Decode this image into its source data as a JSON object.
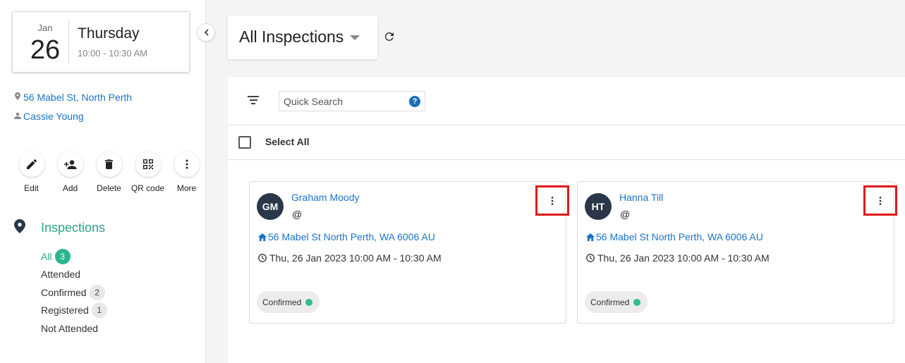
{
  "event": {
    "month": "Jan",
    "day": "26",
    "weekday": "Thursday",
    "time": "10:00 - 10:30 AM",
    "address": "56 Mabel St, North Perth",
    "agent": "Cassie Young"
  },
  "actions": [
    {
      "label": "Edit",
      "icon": "pencil-icon"
    },
    {
      "label": "Add",
      "icon": "add-person-icon"
    },
    {
      "label": "Delete",
      "icon": "trash-icon"
    },
    {
      "label": "QR code",
      "icon": "qr-code-icon"
    },
    {
      "label": "More",
      "icon": "more-vertical-icon"
    }
  ],
  "inspections": {
    "title": "Inspections",
    "filters": [
      {
        "label": "All",
        "count": "3"
      },
      {
        "label": "Attended",
        "count": null
      },
      {
        "label": "Confirmed",
        "count": "2"
      },
      {
        "label": "Registered",
        "count": "1"
      },
      {
        "label": "Not Attended",
        "count": null
      }
    ]
  },
  "main": {
    "title": "All Inspections",
    "search_placeholder": "Quick Search",
    "select_all": "Select All"
  },
  "cards": [
    {
      "initials": "GM",
      "name": "Graham Moody",
      "contact": "@",
      "address": "56 Mabel St North Perth, WA 6006 AU",
      "datetime": "Thu, 26 Jan 2023 10:00 AM - 10:30 AM",
      "status": "Confirmed"
    },
    {
      "initials": "HT",
      "name": "Hanna Till",
      "contact": "@",
      "address": "56 Mabel St North Perth, WA 6006 AU",
      "datetime": "Thu, 26 Jan 2023 10:00 AM - 10:30 AM",
      "status": "Confirmed"
    }
  ],
  "colors": {
    "accent_green": "#2ba58a",
    "link_blue": "#1a73c9",
    "highlight_red": "#e0191b",
    "status_green": "#2bc08e"
  }
}
